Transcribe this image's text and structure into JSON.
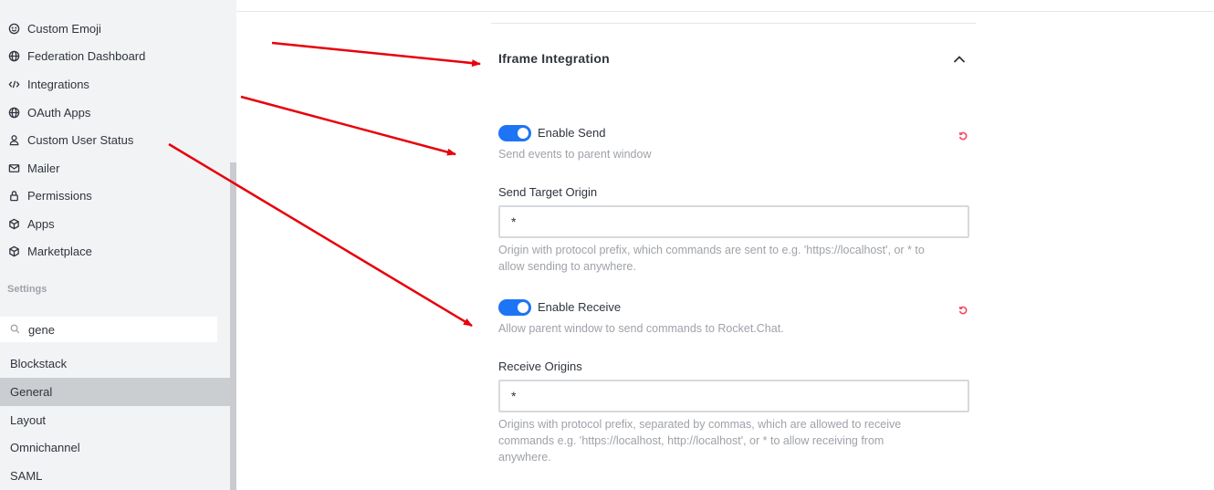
{
  "sidebar": {
    "admin_items": [
      {
        "label": "Custom Emoji",
        "icon": "smiley-icon"
      },
      {
        "label": "Federation Dashboard",
        "icon": "globe-icon"
      },
      {
        "label": "Integrations",
        "icon": "code-icon"
      },
      {
        "label": "OAuth Apps",
        "icon": "globe-icon"
      },
      {
        "label": "Custom User Status",
        "icon": "user-icon"
      },
      {
        "label": "Mailer",
        "icon": "mail-icon"
      },
      {
        "label": "Permissions",
        "icon": "lock-icon"
      },
      {
        "label": "Apps",
        "icon": "cube-icon"
      },
      {
        "label": "Marketplace",
        "icon": "cube-icon"
      }
    ],
    "settings_label": "Settings",
    "search_value": "gene",
    "settings_items": [
      {
        "label": "Blockstack"
      },
      {
        "label": "General",
        "active": true
      },
      {
        "label": "Layout"
      },
      {
        "label": "Omnichannel"
      },
      {
        "label": "SAML"
      }
    ]
  },
  "main": {
    "group_title": "Iframe Integration",
    "enable_send": {
      "label": "Enable Send",
      "checked": true,
      "hint": "Send events to parent window"
    },
    "send_target_origin": {
      "label": "Send Target Origin",
      "value": "*",
      "hint_line1": "Origin with protocol prefix, which commands are sent to e.g. 'https://localhost', or * to",
      "hint_line2": "allow sending to anywhere."
    },
    "enable_receive": {
      "label": "Enable Receive",
      "checked": true,
      "hint": "Allow parent window to send commands to Rocket.Chat."
    },
    "receive_origins": {
      "label": "Receive Origins",
      "value": "*",
      "hint_line1": "Origins with protocol prefix, separated by commas, which are allowed to receive",
      "hint_line2": "commands e.g. 'https://localhost, http://localhost', or * to allow receiving from",
      "hint_line3": "anywhere."
    }
  },
  "colors": {
    "toggle_on": "#1d74f5",
    "reset_icon": "#f5455c",
    "annotation_arrow": "#e8000b",
    "sidebar_bg": "#f2f3f5",
    "active_item_bg": "#cbced1"
  }
}
